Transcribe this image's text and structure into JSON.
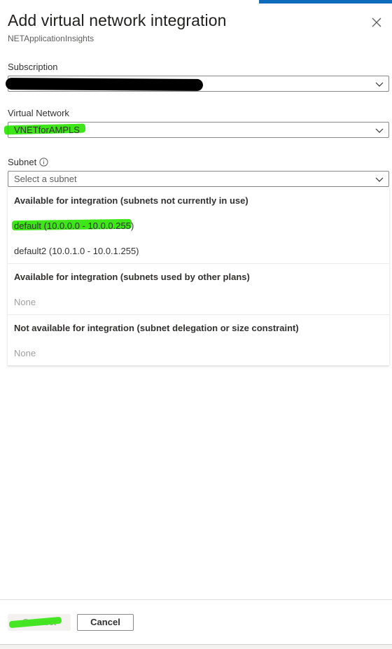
{
  "panel": {
    "title": "Add virtual network integration",
    "subtitle": "NETApplicationInsights"
  },
  "subscription": {
    "label": "Subscription",
    "value": ""
  },
  "virtual_network": {
    "label": "Virtual Network",
    "value": "VNETforAMPLS"
  },
  "subnet": {
    "label": "Subnet",
    "placeholder": "Select a subnet",
    "groups": [
      {
        "header": "Available for integration (subnets not currently in use)",
        "items": [
          "default (10.0.0.0 - 10.0.0.255)",
          "default2 (10.0.1.0 - 10.0.1.255)"
        ]
      },
      {
        "header": "Available for integration (subnets used by other plans)",
        "items": [
          "None"
        ]
      },
      {
        "header": "Not available for integration (subnet delegation or size constraint)",
        "items": [
          "None"
        ]
      }
    ]
  },
  "footer": {
    "connect_label": "Connect",
    "cancel_label": "Cancel"
  },
  "colors": {
    "highlight": "#3de519",
    "accent": "#0f6cbd",
    "redaction": "#000000"
  },
  "icons": {
    "close": "close-icon",
    "chevron": "chevron-down-icon",
    "info": "info-icon"
  }
}
